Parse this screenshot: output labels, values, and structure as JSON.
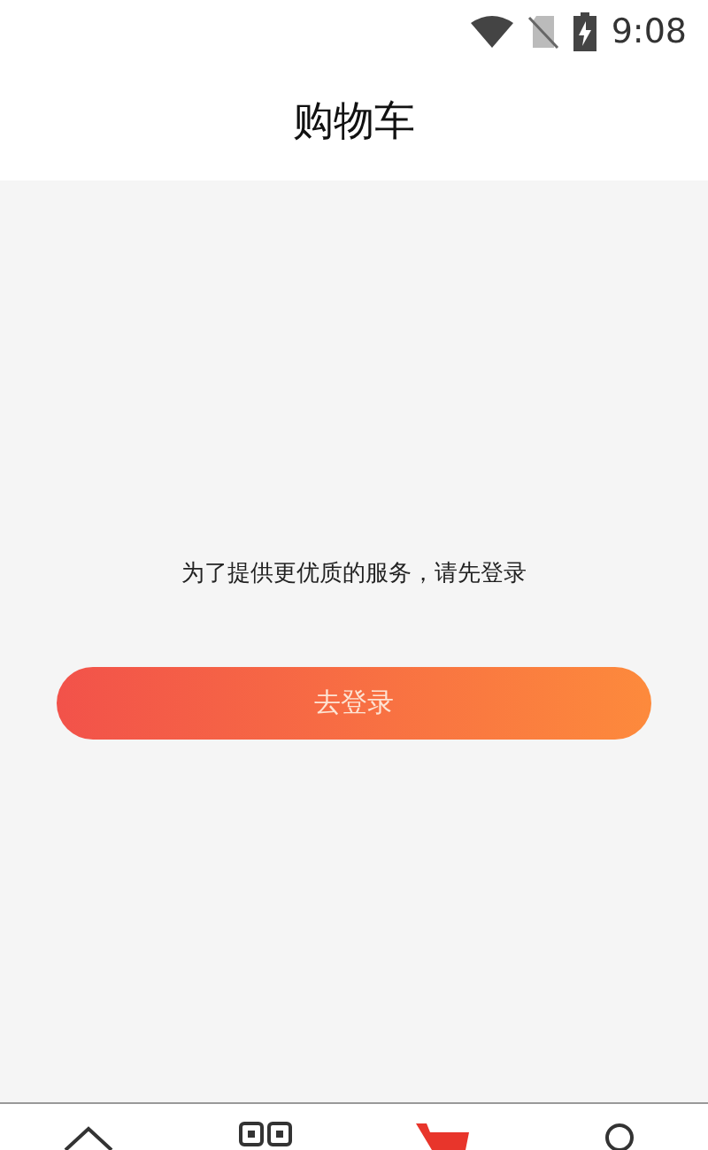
{
  "status_bar": {
    "time": "9:08"
  },
  "header": {
    "title": "购物车"
  },
  "message": "为了提供更优质的服务，请先登录",
  "login_button": "去登录",
  "tab_bar": [
    {
      "kind": "home",
      "selected": false
    },
    {
      "kind": "category",
      "selected": false
    },
    {
      "kind": "cart",
      "selected": true
    },
    {
      "kind": "profile",
      "selected": false
    }
  ]
}
